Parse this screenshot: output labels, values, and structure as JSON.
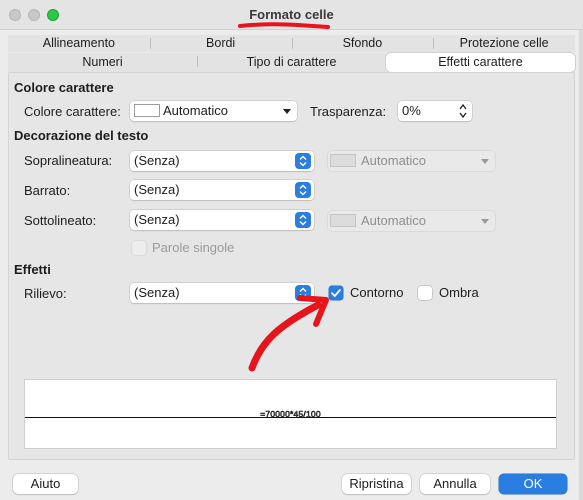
{
  "window": {
    "title": "Formato celle"
  },
  "tabs": {
    "row1": [
      "Allineamento",
      "Bordi",
      "Sfondo",
      "Protezione celle"
    ],
    "row2": [
      "Numeri",
      "Tipo di carattere",
      "Effetti carattere"
    ],
    "active": "Effetti carattere"
  },
  "font_color": {
    "section": "Colore carattere",
    "label": "Colore carattere:",
    "value": "Automatico",
    "transparency_label": "Trasparenza:",
    "transparency_value": "0%"
  },
  "text_decoration": {
    "section": "Decorazione del testo",
    "overline_label": "Sopralineatura:",
    "overline_value": "(Senza)",
    "overline_color": "Automatico",
    "strikethrough_label": "Barrato:",
    "strikethrough_value": "(Senza)",
    "underline_label": "Sottolineato:",
    "underline_value": "(Senza)",
    "underline_color": "Automatico",
    "single_words_label": "Parole singole",
    "single_words_checked": false
  },
  "effects": {
    "section": "Effetti",
    "relief_label": "Rilievo:",
    "relief_value": "(Senza)",
    "outline_label": "Contorno",
    "outline_checked": true,
    "shadow_label": "Ombra",
    "shadow_checked": false
  },
  "preview": {
    "text": "=70000*45/100"
  },
  "buttons": {
    "help": "Aiuto",
    "reset": "Ripristina",
    "cancel": "Annulla",
    "ok": "OK"
  },
  "colors": {
    "accent": "#2a7de1",
    "annotation": "#e8141b"
  }
}
